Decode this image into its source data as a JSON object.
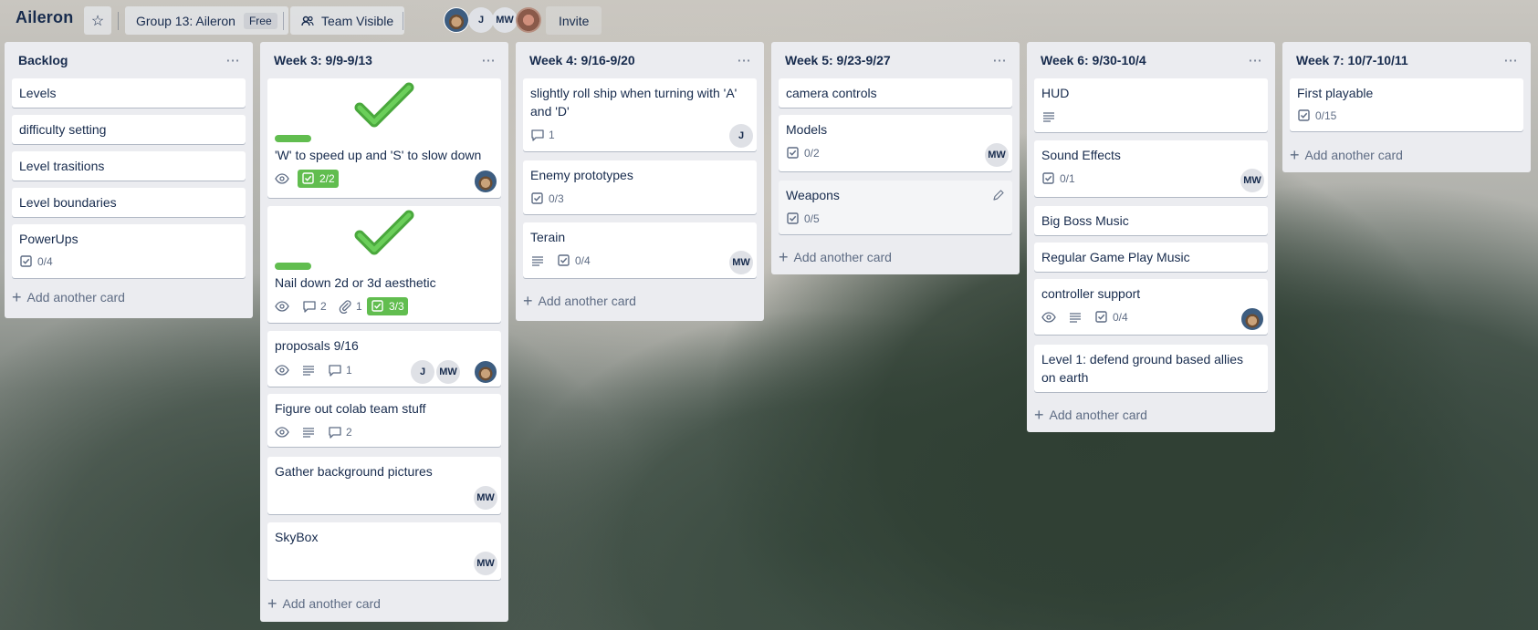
{
  "header": {
    "board_name": "Aileron",
    "team_button": "Group 13: Aileron",
    "free_badge": "Free",
    "visibility_button": "Team Visible",
    "members": [
      "J",
      "MW"
    ],
    "invite_button": "Invite"
  },
  "lists": [
    {
      "title": "Backlog",
      "cards": [
        {
          "title": "Levels"
        },
        {
          "title": "difficulty setting"
        },
        {
          "title": "Level trasitions"
        },
        {
          "title": "Level boundaries"
        },
        {
          "title": "PowerUps",
          "checklist": "0/4"
        }
      ],
      "add_label": "Add another card"
    },
    {
      "title": "Week 3: 9/9-9/13",
      "cards": [
        {
          "title": "'W' to speed up and 'S' to slow down",
          "checklist": "2/2"
        },
        {
          "title": "Nail down 2d or 3d aesthetic",
          "comments": "2",
          "attachments": "1",
          "checklist": "3/3"
        },
        {
          "title": "proposals 9/16",
          "comments": "1",
          "members": [
            "J",
            "MW"
          ]
        },
        {
          "title": "Figure out colab team stuff",
          "comments": "2"
        },
        {
          "title": "Gather background pictures",
          "members": [
            "MW"
          ]
        },
        {
          "title": "SkyBox",
          "members": [
            "MW"
          ]
        }
      ],
      "add_label": "Add another card"
    },
    {
      "title": "Week 4: 9/16-9/20",
      "cards": [
        {
          "title": "slightly roll ship when turning with 'A' and 'D'",
          "comments": "1",
          "members": [
            "J"
          ]
        },
        {
          "title": "Enemy prototypes",
          "checklist": "0/3"
        },
        {
          "title": "Terain",
          "checklist": "0/4",
          "members": [
            "MW"
          ]
        }
      ],
      "add_label": "Add another card"
    },
    {
      "title": "Week 5: 9/23-9/27",
      "cards": [
        {
          "title": "camera controls"
        },
        {
          "title": "Models",
          "checklist": "0/2",
          "members": [
            "MW"
          ]
        },
        {
          "title": "Weapons",
          "checklist": "0/5"
        }
      ],
      "add_label": "Add another card"
    },
    {
      "title": "Week 6: 9/30-10/4",
      "cards": [
        {
          "title": "HUD"
        },
        {
          "title": "Sound Effects",
          "checklist": "0/1",
          "members": [
            "MW"
          ]
        },
        {
          "title": "Big Boss Music"
        },
        {
          "title": "Regular Game Play Music"
        },
        {
          "title": "controller support",
          "checklist": "0/4"
        },
        {
          "title": "Level 1: defend ground based allies on earth"
        }
      ],
      "add_label": "Add another card"
    },
    {
      "title": "Week 7: 10/7-10/11",
      "cards": [
        {
          "title": "First playable",
          "checklist": "0/15"
        }
      ],
      "add_label": "Add another card"
    }
  ],
  "colors": {
    "label_green": "#61bd4f",
    "list_bg": "#ebecf0",
    "text": "#172b4d",
    "muted": "#5e6c84"
  }
}
